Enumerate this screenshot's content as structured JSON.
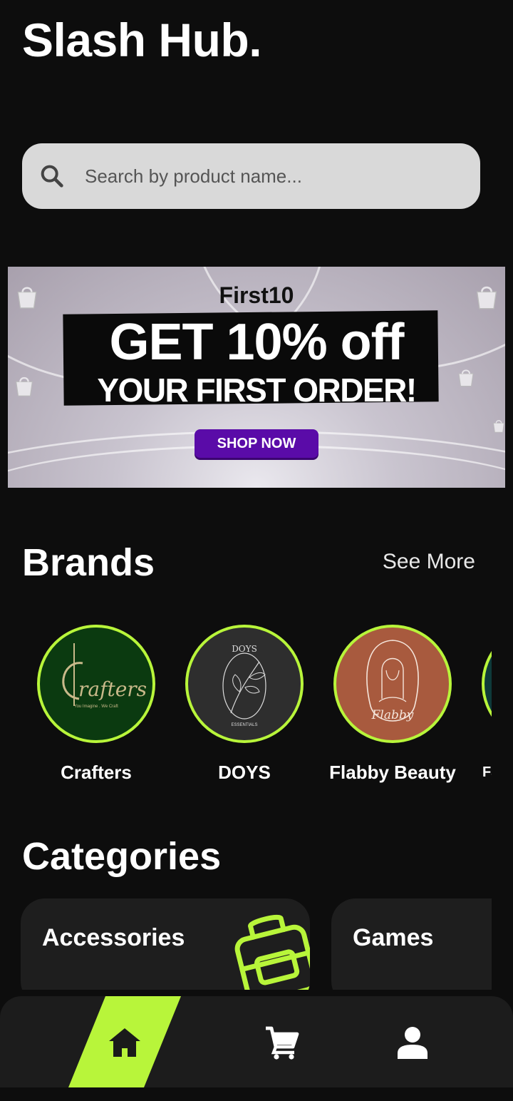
{
  "app": {
    "title": "Slash Hub."
  },
  "search": {
    "placeholder": "Search by product name..."
  },
  "banner": {
    "code": "First10",
    "headline": "GET 10% off",
    "subheadline": "YOUR FIRST ORDER!",
    "cta": "SHOP NOW"
  },
  "brands": {
    "title": "Brands",
    "see_more": "See More",
    "items": [
      {
        "name": "Crafters",
        "logo_text": "rafters",
        "logo_tagline": "You Imagine . We Craft"
      },
      {
        "name": "DOYS",
        "logo_text": "DOYS",
        "logo_tagline": "ESSENTIALS"
      },
      {
        "name": "Flabby Beauty",
        "logo_text": "Flabby"
      },
      {
        "name": "Fa"
      }
    ]
  },
  "categories": {
    "title": "Categories",
    "items": [
      {
        "label": "Accessories",
        "icon": "backpack-icon"
      },
      {
        "label": "Games"
      }
    ]
  },
  "nav": {
    "items": [
      {
        "icon": "home-icon",
        "active": true
      },
      {
        "icon": "cart-icon",
        "active": false
      },
      {
        "icon": "user-icon",
        "active": false
      }
    ]
  },
  "colors": {
    "accent": "#b8f53a",
    "background": "#0d0d0d",
    "card": "#1e1e1e",
    "search_bg": "#d9d9d9",
    "banner_button": "#5a0ba8"
  }
}
